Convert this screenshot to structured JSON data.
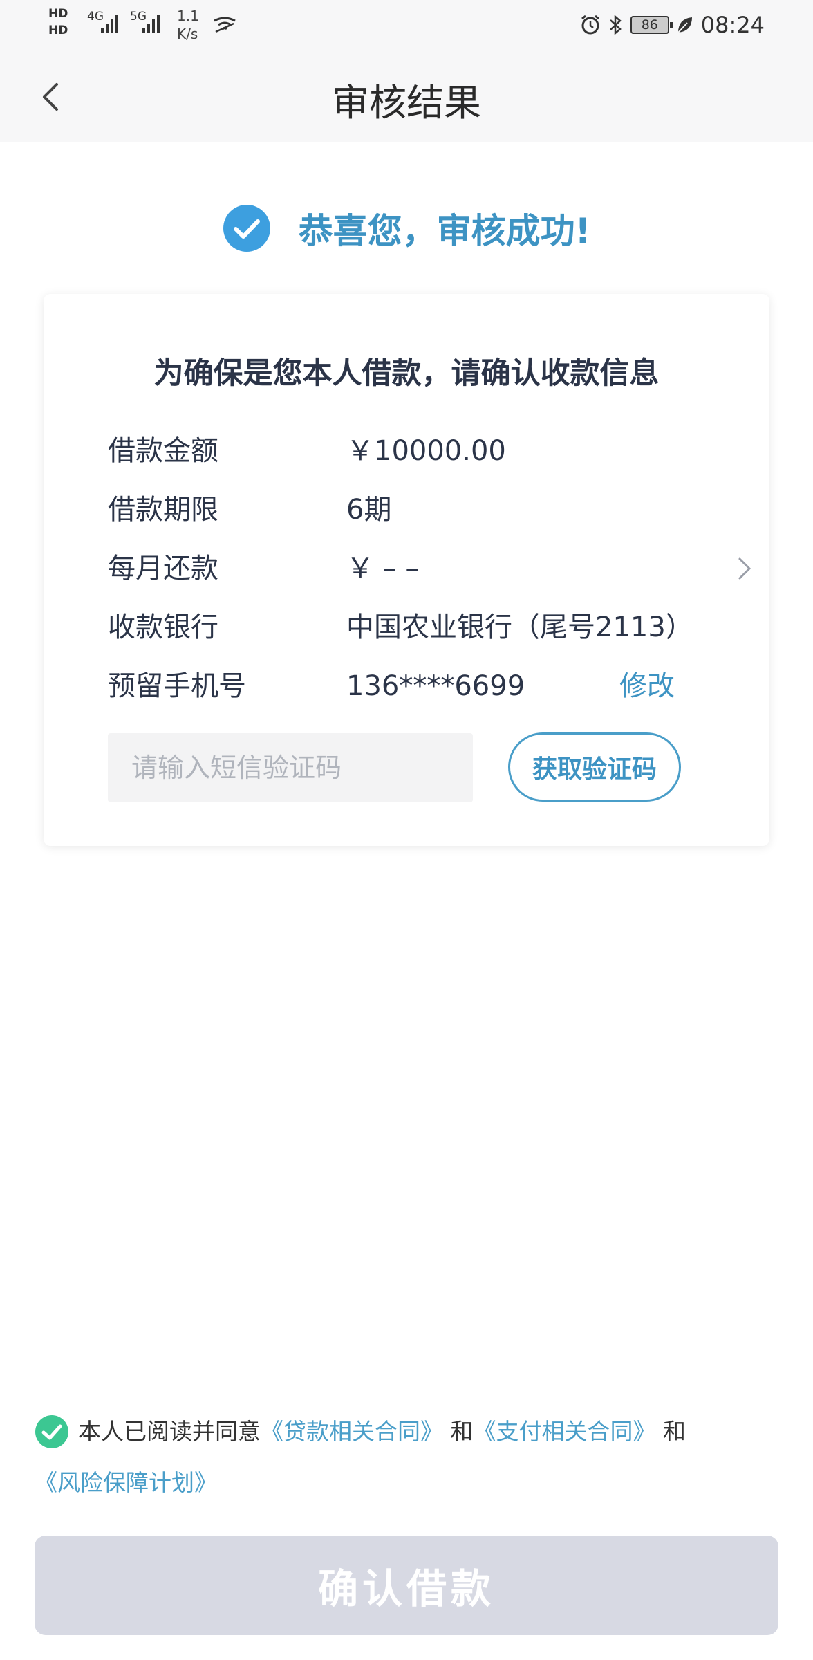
{
  "status_bar": {
    "hd1": "HD",
    "hd2": "HD",
    "net1": "4G",
    "net2": "5G",
    "speed_value": "1.1",
    "speed_unit": "K/s",
    "battery": "86",
    "time": "08:24"
  },
  "header": {
    "title": "审核结果"
  },
  "success": {
    "message": "恭喜您，审核成功!"
  },
  "card": {
    "title": "为确保是您本人借款，请确认收款信息",
    "rows": [
      {
        "label": "借款金额",
        "value": "￥10000.00"
      },
      {
        "label": "借款期限",
        "value": "6期"
      },
      {
        "label": "每月还款",
        "value": "￥ – –"
      },
      {
        "label": "收款银行",
        "value": "中国农业银行（尾号2113）"
      },
      {
        "label": "预留手机号",
        "value": "136****6699"
      }
    ],
    "modify_label": "修改",
    "sms_placeholder": "请输入短信验证码",
    "get_code_label": "获取验证码"
  },
  "agreement": {
    "prefix": "本人已阅读并同意",
    "loan_contract": "《贷款相关合同》",
    "and1": "和",
    "payment_contract": "《支付相关合同》",
    "and2": "和",
    "risk_plan": "《风险保障计划》"
  },
  "confirm_button": "确认借款",
  "colors": {
    "accent": "#3d93c3",
    "check_green": "#3cc792",
    "button_disabled": "#d7d9e3"
  }
}
